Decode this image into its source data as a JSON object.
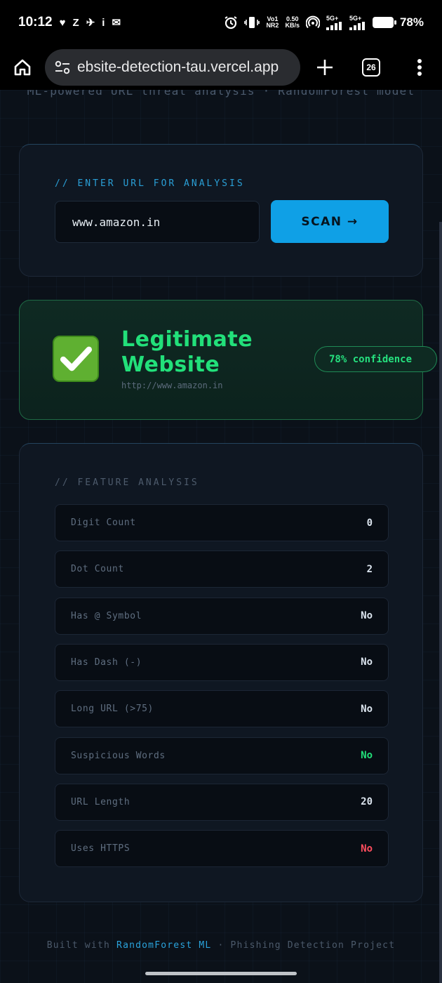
{
  "status_bar": {
    "time": "10:12",
    "left_glyphs": [
      "♥",
      "Z",
      "✈",
      "i",
      "✉"
    ],
    "volte_top": "Vo1",
    "volte_bottom": "NR2",
    "speed_top": "0.50",
    "speed_bottom": "KB/s",
    "net1": "5G+",
    "net2": "5G+",
    "battery": "78%"
  },
  "browser": {
    "url": "ebsite-detection-tau.vercel.app",
    "tab_count": "26"
  },
  "page": {
    "subtitle": "ML-powered URL threat analysis · RandomForest model",
    "input_section_label": "// ENTER URL FOR ANALYSIS",
    "url_value": "www.amazon.in",
    "scan_label": "SCAN →",
    "result": {
      "line1": "Legitimate",
      "line2": "Website",
      "url": "http://www.amazon.in",
      "confidence": "78% confidence",
      "color": "#22e07a"
    },
    "features_label": "// FEATURE ANALYSIS",
    "features": [
      {
        "name": "Digit Count",
        "value": "0",
        "color": "#dbe4ee"
      },
      {
        "name": "Dot Count",
        "value": "2",
        "color": "#dbe4ee"
      },
      {
        "name": "Has @ Symbol",
        "value": "No",
        "color": "#dbe4ee"
      },
      {
        "name": "Has Dash (-)",
        "value": "No",
        "color": "#dbe4ee"
      },
      {
        "name": "Long URL (>75)",
        "value": "No",
        "color": "#dbe4ee"
      },
      {
        "name": "Suspicious Words",
        "value": "No",
        "color": "#22e07a"
      },
      {
        "name": "URL Length",
        "value": "20",
        "color": "#dbe4ee"
      },
      {
        "name": "Uses HTTPS",
        "value": "No",
        "color": "#ff4d5e"
      }
    ],
    "footer_prefix": "Built with ",
    "footer_accent": "RandomForest ML",
    "footer_suffix": " · Phishing Detection Project"
  }
}
